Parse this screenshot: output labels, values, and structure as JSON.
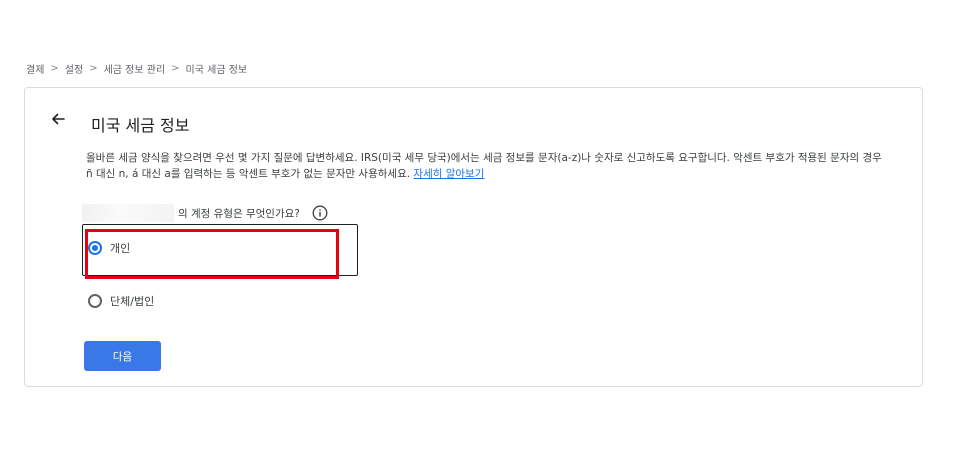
{
  "breadcrumb": {
    "items": [
      "결제",
      "설정",
      "세금 정보 관리",
      "미국 세금 정보"
    ],
    "separator": ">"
  },
  "card": {
    "title": "미국 세금 정보",
    "description": "올바른 세금 양식을 찾으려면 우선 몇 가지 질문에 답변하세요. IRS(미국 세무 당국)에서는 세금 정보를 문자(a-z)나 숫자로 신고하도록 요구합니다. 악센트 부호가 적용된 문자의 경우 ñ 대신 n, á 대신 a를 입력하는 등 악센트 부호가 없는 문자만 사용하세요.",
    "learn_more": "자세히 알아보기",
    "question": "의 계정 유형은 무엇인가요?",
    "options": [
      {
        "label": "개인",
        "selected": true
      },
      {
        "label": "단체/법인",
        "selected": false
      }
    ],
    "next_label": "다음"
  },
  "icons": {
    "back": "arrow-back-icon",
    "info": "info-icon",
    "radio": "radio-icon"
  },
  "colors": {
    "accent": "#1a73e8",
    "button": "#3b78e7",
    "highlight": "#e60012"
  }
}
